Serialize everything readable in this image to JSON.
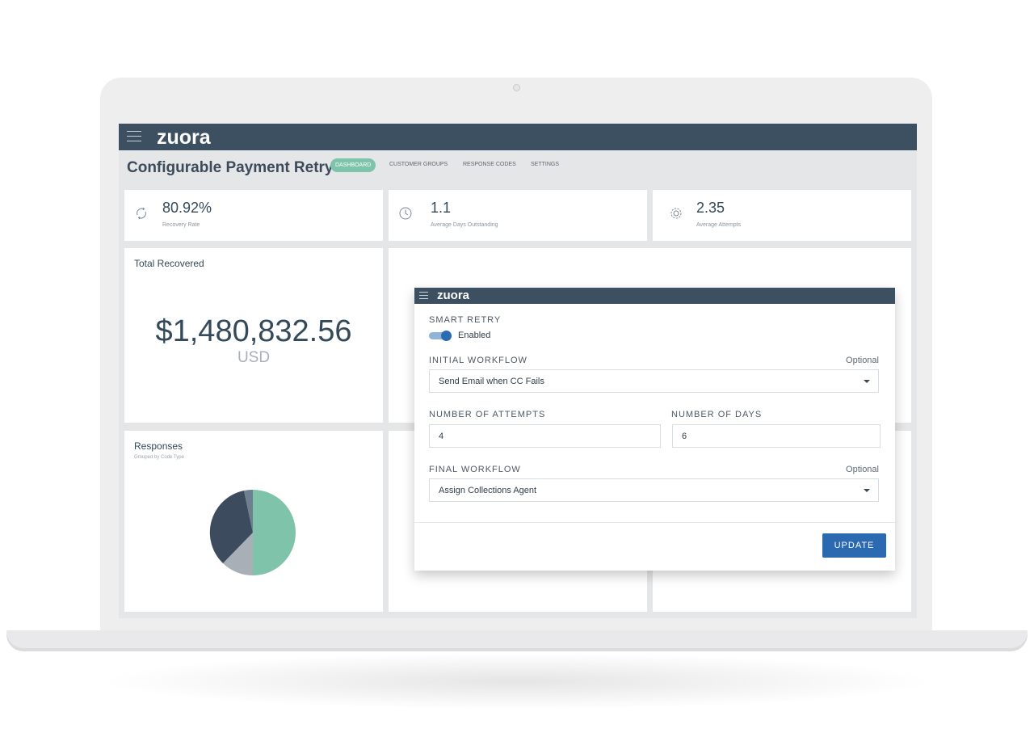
{
  "app": {
    "logo": "zuora",
    "page_title": "Configurable Payment Retry",
    "tabs": [
      {
        "label": "DASHBOARD",
        "active": true
      },
      {
        "label": "CUSTOMER GROUPS",
        "active": false
      },
      {
        "label": "RESPONSE CODES",
        "active": false
      },
      {
        "label": "SETTINGS",
        "active": false
      }
    ]
  },
  "kpis": [
    {
      "icon": "refresh-icon",
      "value": "80.92%",
      "label": "Recovery Rate"
    },
    {
      "icon": "clock-icon",
      "value": "1.1",
      "label": "Average Days Outstanding"
    },
    {
      "icon": "gear-icon",
      "value": "2.35",
      "label": "Average  Attempts"
    }
  ],
  "total_recovered": {
    "title": "Total Recovered",
    "amount": "$1,480,832.56",
    "currency": "USD"
  },
  "responses": {
    "title": "Responses",
    "subtitle": "Grouped by Code Type",
    "pie_colors": [
      "#7fc4aa",
      "#a9afb7",
      "#3c4c5e",
      "#6e7f8e"
    ]
  },
  "modal": {
    "logo": "zuora",
    "smart_retry_label": "SMART RETRY",
    "smart_retry_state": "Enabled",
    "initial_workflow_label": "INITIAL WORKFLOW",
    "initial_workflow_optional": "Optional",
    "initial_workflow_value": "Send Email when CC Fails",
    "attempts_label": "NUMBER OF ATTEMPTS",
    "attempts_value": "4",
    "days_label": "NUMBER OF DAYS",
    "days_value": "6",
    "final_workflow_label": "FINAL WORKFLOW",
    "final_workflow_optional": "Optional",
    "final_workflow_value": "Assign Collections Agent",
    "update_label": "UPDATE"
  },
  "colors": {
    "topbar": "#3c5061",
    "accent_green": "#7dc4aa",
    "primary_button": "#2b69b0"
  }
}
